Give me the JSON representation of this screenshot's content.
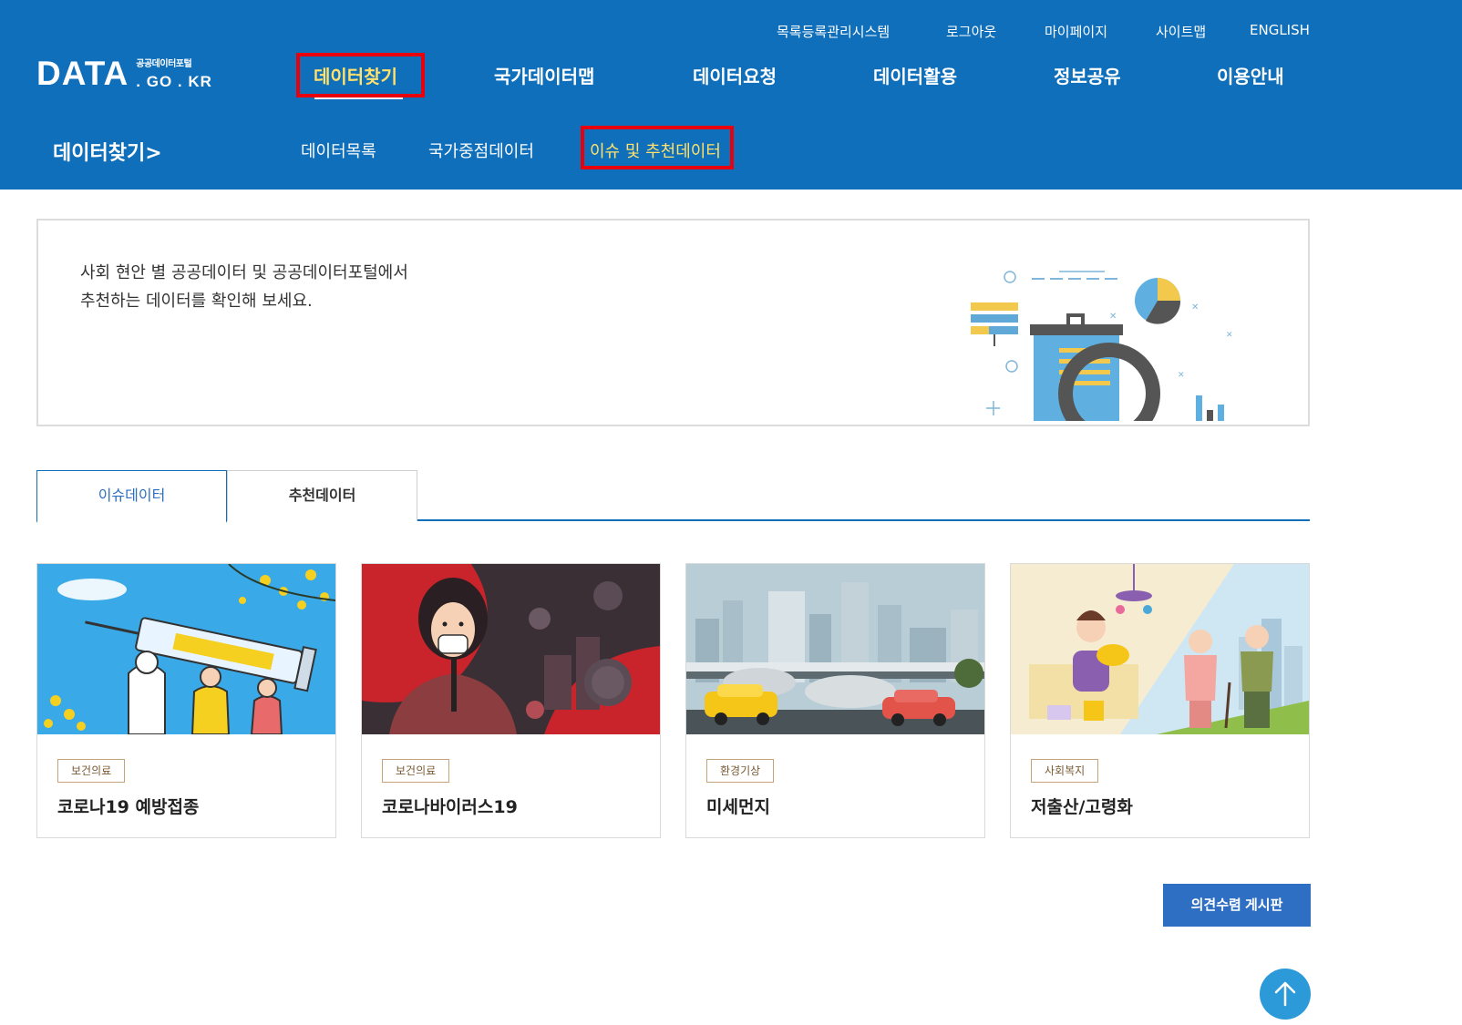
{
  "logo": {
    "main": "DATA",
    "sub_top": "공공데이터포털",
    "sub_bottom": ". GO . KR"
  },
  "util_nav": [
    "목록등록관리시스템",
    "로그아웃",
    "마이페이지",
    "사이트맵",
    "ENGLISH"
  ],
  "gnb": [
    "데이터찾기",
    "국가데이터맵",
    "데이터요청",
    "데이터활용",
    "정보공유",
    "이용안내"
  ],
  "section_title": "데이터찾기>",
  "lnb": [
    "데이터목록",
    "국가중점데이터",
    "이슈 및 추천데이터"
  ],
  "intro": {
    "line1": "사회 현안 별 공공데이터 및 공공데이터포털에서",
    "line2": "추천하는 데이터를 확인해 보세요."
  },
  "tabs": [
    "이슈데이터",
    "추천데이터"
  ],
  "cards": [
    {
      "category": "보건의료",
      "title": "코로나19 예방접종"
    },
    {
      "category": "보건의료",
      "title": "코로나바이러스19"
    },
    {
      "category": "환경기상",
      "title": "미세먼지"
    },
    {
      "category": "사회복지",
      "title": "저출산/고령화"
    }
  ],
  "opinion_button": "의견수렴 게시판",
  "colors": {
    "header_bg": "#0f6fba",
    "active_menu": "#ffe16b",
    "highlight": "#e8000c",
    "button": "#2e6fc4",
    "top_button": "#2c9ad8"
  },
  "icons": {
    "top_button": "arrow-up-icon"
  }
}
